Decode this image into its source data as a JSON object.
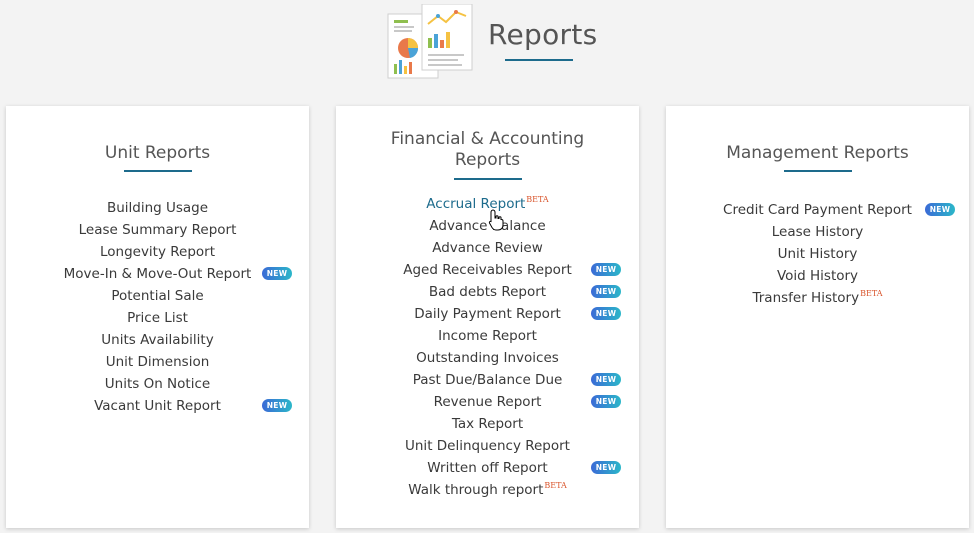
{
  "page": {
    "title": "Reports"
  },
  "badge_label": "NEW",
  "beta_label": "BETA",
  "colors": {
    "accent": "#1d6b8c",
    "badge_start": "#3b6ad6",
    "badge_end": "#2bb7c9",
    "beta": "#d9542b"
  },
  "cards": [
    {
      "title": [
        "Unit Reports"
      ],
      "items": [
        {
          "label": "Building Usage"
        },
        {
          "label": "Lease Summary Report"
        },
        {
          "label": "Longevity Report"
        },
        {
          "label": "Move-In & Move-Out Report",
          "new": true
        },
        {
          "label": "Potential Sale"
        },
        {
          "label": "Price List"
        },
        {
          "label": "Units Availability"
        },
        {
          "label": "Unit Dimension"
        },
        {
          "label": "Units On Notice"
        },
        {
          "label": "Vacant Unit Report",
          "new": true
        }
      ]
    },
    {
      "title": [
        "Financial & Accounting",
        "Reports"
      ],
      "items": [
        {
          "label": "Accrual Report",
          "beta": true,
          "active": true
        },
        {
          "label": "Advance Balance"
        },
        {
          "label": "Advance Review"
        },
        {
          "label": "Aged Receivables Report",
          "new": true
        },
        {
          "label": "Bad debts Report",
          "new": true
        },
        {
          "label": "Daily Payment Report",
          "new": true
        },
        {
          "label": "Income Report"
        },
        {
          "label": "Outstanding Invoices"
        },
        {
          "label": "Past Due/Balance Due",
          "new": true
        },
        {
          "label": "Revenue Report",
          "new": true
        },
        {
          "label": "Tax Report"
        },
        {
          "label": "Unit Delinquency Report"
        },
        {
          "label": "Written off Report",
          "new": true
        },
        {
          "label": "Walk through report",
          "beta": true
        }
      ]
    },
    {
      "title": [
        "Management Reports"
      ],
      "items": [
        {
          "label": "Credit Card Payment Report",
          "new": true
        },
        {
          "label": "Lease History"
        },
        {
          "label": "Unit History"
        },
        {
          "label": "Void History"
        },
        {
          "label": "Transfer History",
          "beta": true
        }
      ]
    }
  ]
}
